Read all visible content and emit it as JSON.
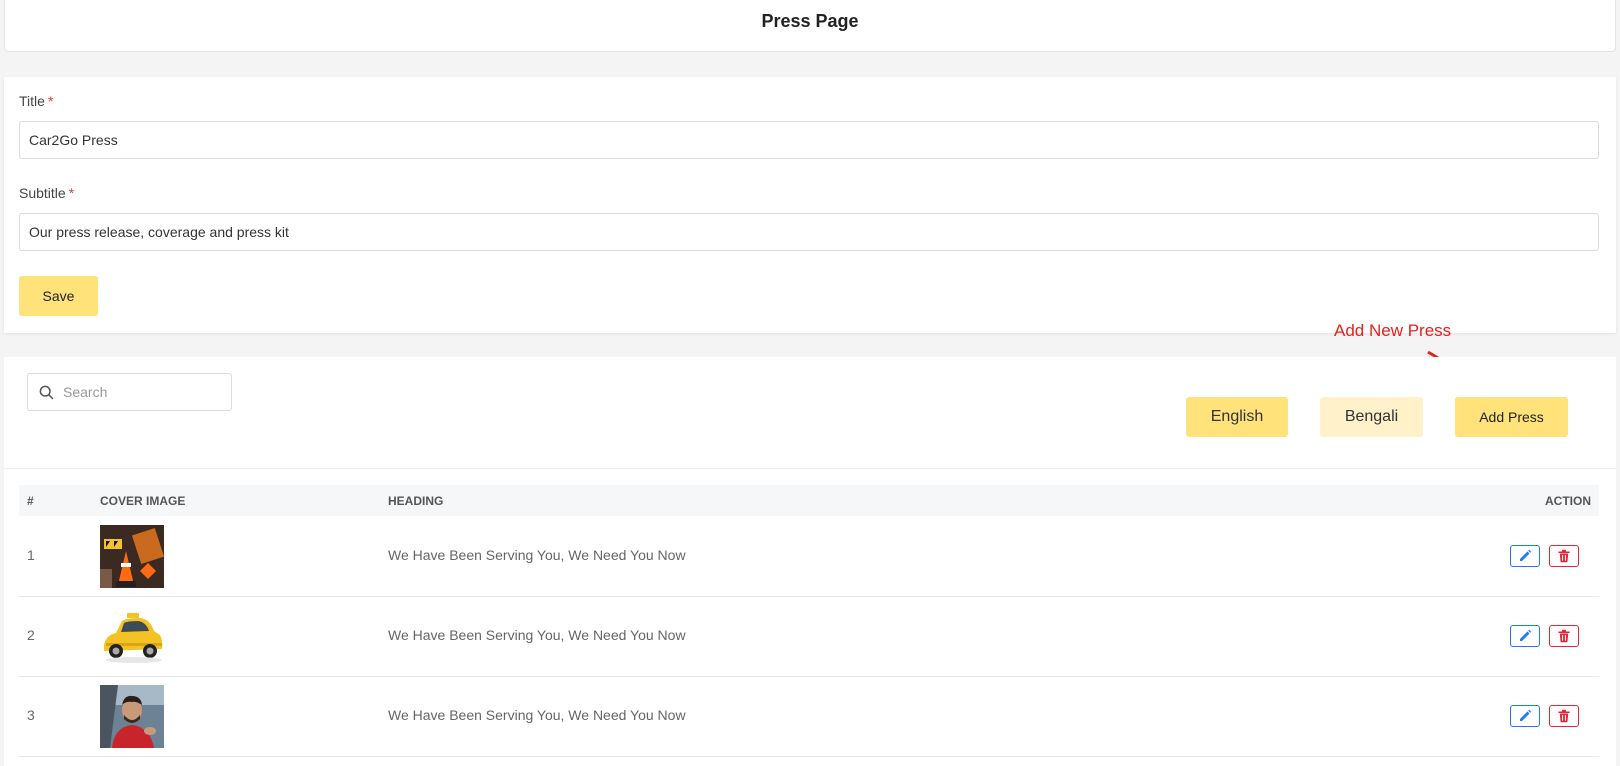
{
  "header": {
    "title": "Press Page"
  },
  "form": {
    "title_label": "Title",
    "title_value": "Car2Go Press",
    "subtitle_label": "Subtitle",
    "subtitle_value": "Our press release, coverage and press kit",
    "required_mark": "*",
    "save_label": "Save"
  },
  "list": {
    "search_placeholder": "Search",
    "languages": [
      "English",
      "Bengali"
    ],
    "add_label": "Add Press",
    "annotation": "Add New Press",
    "columns": [
      "#",
      "COVER IMAGE",
      "HEADING",
      "ACTION"
    ],
    "rows": [
      {
        "num": "1",
        "image": "construction-cones",
        "heading": "We Have Been Serving You, We Need You Now"
      },
      {
        "num": "2",
        "image": "yellow-taxi",
        "heading": "We Have Been Serving You, We Need You Now"
      },
      {
        "num": "3",
        "image": "driver-in-car",
        "heading": "We Have Been Serving You, We Need You Now"
      }
    ]
  },
  "colors": {
    "accent_yellow": "#ffe27a",
    "light_yellow": "#fff1c9",
    "edit_blue": "#1e7cf2",
    "delete_red": "#e0273a",
    "annotation_red": "#e8201a"
  }
}
